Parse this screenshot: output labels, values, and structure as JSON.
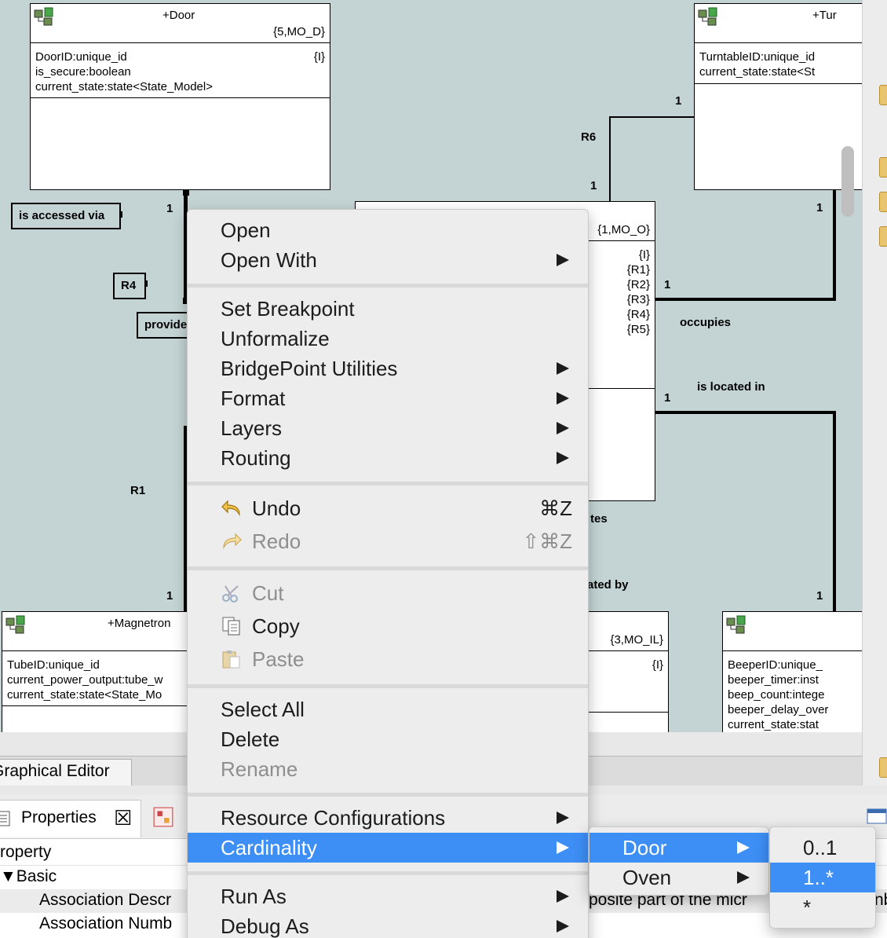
{
  "diagram": {
    "classes": {
      "door": {
        "name": "+Door",
        "key": "{5,MO_D}",
        "attributes": [
          "DoorID:unique_id",
          "is_secure:boolean",
          "current_state:state<State_Model>"
        ],
        "tags": [
          "{I}"
        ]
      },
      "turntable": {
        "name": "+Tur",
        "attributes": [
          "TurntableID:unique_id",
          "current_state:state<St"
        ]
      },
      "oven": {
        "key": "{1,MO_O}",
        "tags": [
          "{I}",
          "{R1}",
          "{R2}",
          "{R3}",
          "{R4}",
          "{R5}"
        ]
      },
      "magnetron": {
        "name": "+Magnetron",
        "attributes": [
          "TubeID:unique_id",
          "current_power_output:tube_w",
          "current_state:state<State_Mo"
        ]
      },
      "light": {
        "key": "{3,MO_IL}",
        "tags": [
          "{I}"
        ]
      },
      "beeper": {
        "attributes": [
          "BeeperID:unique_",
          "beeper_timer:inst",
          "beep_count:intege",
          "beeper_delay_over",
          "current_state:stat"
        ]
      }
    },
    "labels": {
      "is_accessed_via": "is accessed via",
      "r4": "R4",
      "provides": "provides",
      "r6": "R6",
      "r1": "R1",
      "occupies": "occupies",
      "is_located_in": "is located in",
      "tes": "tes",
      "ated_by": "ated by",
      "one_door": "1",
      "one_turntable_top": "1",
      "one_turntable_bottom": "1",
      "one_right_top": "1",
      "one_oven_right_1": "1",
      "one_oven_right_2": "1",
      "one_magnetron": "1",
      "one_beeper": "1"
    }
  },
  "editor_tab": {
    "label": "Graphical Editor"
  },
  "properties": {
    "tab_label": "Properties",
    "header": "roperty",
    "group": "Basic",
    "rows": [
      {
        "label": "Association Descr",
        "value": "posite part of the micr"
      },
      {
        "label": "Association Numb"
      }
    ],
    "right_overflow": "nb"
  },
  "context_menu": {
    "items": {
      "open": "Open",
      "open_with": "Open With",
      "set_breakpoint": "Set Breakpoint",
      "unformalize": "Unformalize",
      "bridgepoint_utilities": "BridgePoint Utilities",
      "format": "Format",
      "layers": "Layers",
      "routing": "Routing",
      "undo": "Undo",
      "undo_shortcut": "⌘Z",
      "redo": "Redo",
      "redo_shortcut": "⇧⌘Z",
      "cut": "Cut",
      "copy": "Copy",
      "paste": "Paste",
      "select_all": "Select All",
      "delete": "Delete",
      "rename": "Rename",
      "resource_configurations": "Resource Configurations",
      "cardinality": "Cardinality",
      "run_as": "Run As",
      "debug_as": "Debug As"
    }
  },
  "cardinality_submenu": {
    "items": [
      "Door",
      "Oven"
    ],
    "selected": "Door"
  },
  "door_submenu": {
    "items": [
      "0..1",
      "1..*",
      "*"
    ],
    "selected": "1..*"
  },
  "colors": {
    "canvas": "#c4d4d4",
    "menu_highlight": "#3d8ef5",
    "menu_bg": "#ededed"
  }
}
